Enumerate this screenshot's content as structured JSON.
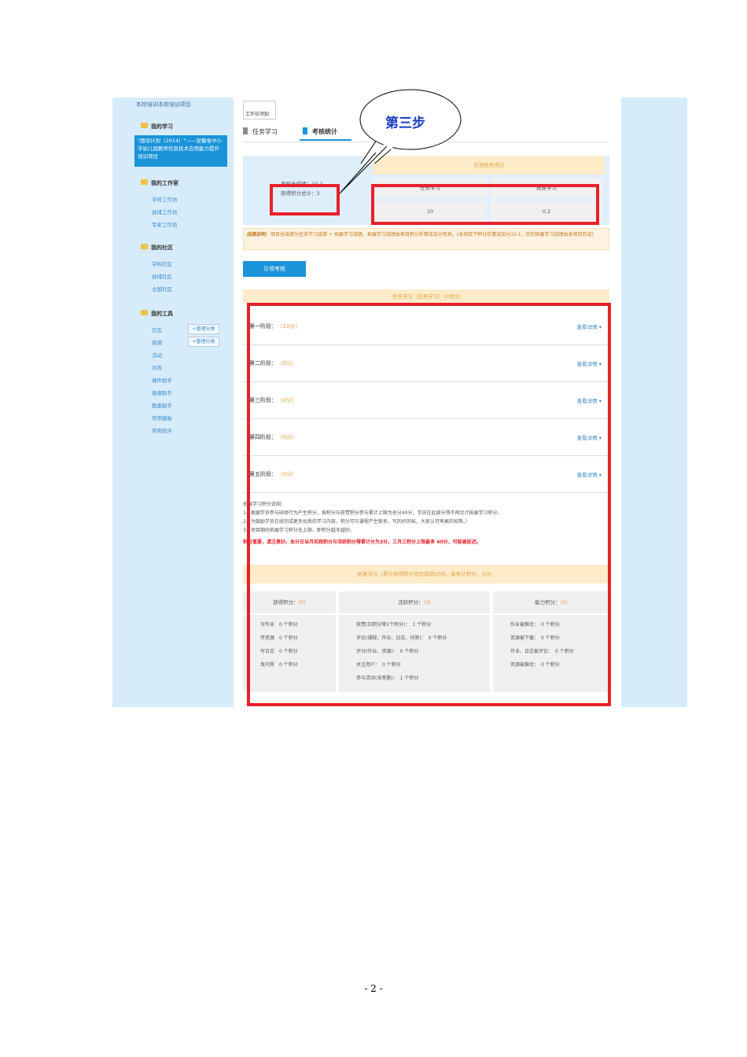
{
  "sidebar": {
    "top_text": "本校培训本校培训项目",
    "sections": [
      {
        "label": "我的学习"
      },
      {
        "label": "我的工作室"
      },
      {
        "label": "我的社区"
      },
      {
        "label": "我的工具"
      }
    ],
    "active_item": "\"国培计划（2014）\"——安徽省中小学幼儿园教师信息技术应用能力提升培训项目",
    "workroom_links": [
      "学校工作坊",
      "县域工作坊",
      "专家工作坊"
    ],
    "community_links": [
      "学校社区",
      "县域社区",
      "全国社区"
    ],
    "tool_links": [
      "日志",
      "资源",
      "活动",
      "问答",
      "课件助手",
      "微课助手",
      "教案助手",
      "常用模板",
      "常用软件"
    ],
    "manage_btn_1": "+管理分类",
    "manage_btn_2": "+管理分类"
  },
  "main": {
    "top_box_text": "工作坊须知",
    "tabs": [
      {
        "label": "任务学习"
      },
      {
        "label": "考核统计"
      }
    ],
    "summary": {
      "score_line": "考核总成绩：10.2",
      "credit_line": "获得积分总计：3",
      "header": "引领任务得分",
      "cells": [
        "任务学习",
        "拓展学习",
        "10",
        "0.2"
      ]
    },
    "tip_bold": "成绩说明：",
    "tip_text": "项目总成绩为任务学习成绩 + 拓展学习成绩。拓展学习成绩由项目积分折算成加分而来。(本项目下积分折算成加分10.1，您的拓展学习成绩由本项目完成)",
    "button_label": "引领考核",
    "task_header": "任务学习（任务学习）10积分",
    "stages": [
      {
        "label": "第一阶段：",
        "score": "（10分）",
        "link": "查看详情 ▾"
      },
      {
        "label": "第二阶段：",
        "score": "（0分）",
        "link": "查看详情 ▾"
      },
      {
        "label": "第三阶段：",
        "score": "（0分）",
        "link": "查看详情 ▾"
      },
      {
        "label": "第四阶段：",
        "score": "（0分）",
        "link": "查看详情 ▾"
      },
      {
        "label": "第五阶段：",
        "score": "（0分）",
        "link": "查看详情 ▾"
      }
    ],
    "notes": [
      "拓展学习积分说明：",
      "1、根据学员参与研修行为产生积分，按积分与获赞积分参与累计上限为总分40分，学员在此部分得不再另计拓展学习积分。",
      "2、为鼓励学员在线完成更多优质的学习内容，积分可与课程产生联系，写的好的帖，大家认可率高的帖等。）",
      "3、项目期间拓展学习积分无上限，即积分越多越好。"
    ],
    "warning": "积分重要，请注意好。本分日当月实践积分与活跃积分得累计分为3分，三月三积分上限最多 40分，可能被延迟。",
    "practice_header": "拓展学习（累计获得积分项目成绩20分，单条计积分，3分）",
    "columns": [
      {
        "head": "获得积分：",
        "score": "(0)",
        "items": [
          "写作业　0 个积分",
          "传资源　0 个积分",
          "写日志　0 个积分",
          "发问答　0 个积分"
        ]
      },
      {
        "head": "活跃积分：",
        "score": "(3)",
        "items": [
          "获赞(日积分等1个积分)：　1 个积分",
          "评论(课程、作业、日志、问答)：　0 个积分",
          "评分(作业、资源)：　0 个积分",
          "关注用户：　0 个积分",
          "参与活动(含答题)：　1 个积分"
        ]
      },
      {
        "head": "能力积分：",
        "score": "(0)",
        "items": [
          "作业被推优：　0 个积分",
          "资源被下载：　0 个积分",
          "作业、日志被评论：　0 个积分",
          "资源被推优：　0 个积分"
        ]
      }
    ]
  },
  "callout": {
    "text": "第三步"
  },
  "page_number": "- 2 -"
}
